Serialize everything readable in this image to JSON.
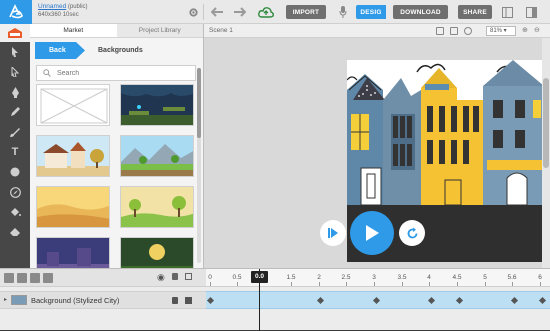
{
  "header": {
    "project_name": "Unnamed",
    "visibility": "(public)",
    "resolution": "640x360",
    "duration": "10sec",
    "buttons": {
      "import": "IMPORT",
      "design": "DESIG",
      "download": "DOWNLOAD",
      "share": "SHARE"
    },
    "icons": [
      "gear-icon",
      "undo-icon",
      "redo-icon",
      "cloud-save-icon",
      "microphone-icon",
      "layout-icon",
      "panel-icon"
    ]
  },
  "library": {
    "tabs": [
      "Market",
      "Project Library"
    ],
    "active_tab": "Market",
    "back_label": "Back",
    "breadcrumb": "Backgrounds",
    "search_placeholder": "Search"
  },
  "stage": {
    "scene_label": "Scene 1",
    "zoom": "81%"
  },
  "timeline": {
    "ticks": [
      "0",
      "0.5",
      "0.0",
      "1.5",
      "2",
      "2.5",
      "3",
      "3.5",
      "4",
      "4.5",
      "5",
      "5.6",
      "6"
    ],
    "playhead_label": "0.0",
    "layer_name": "Background (Stylized City)"
  },
  "colors": {
    "accent": "#2e9ae8",
    "dark": "#474747"
  }
}
